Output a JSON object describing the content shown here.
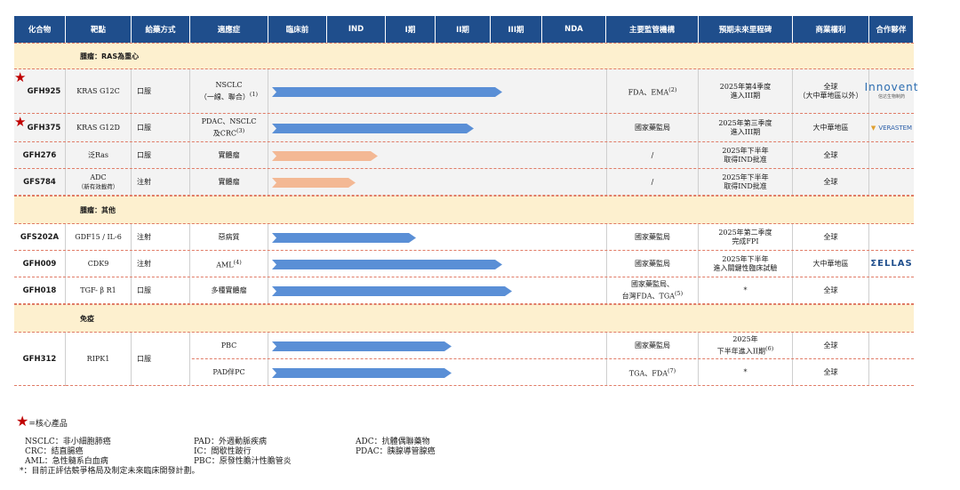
{
  "header": [
    "化合物",
    "靶點",
    "給藥方式",
    "適應症",
    "臨床前",
    "IND",
    "I期",
    "II期",
    "III期",
    "NDA",
    "主要監管機構",
    "預期未來里程碑",
    "商業權利",
    "合作夥伴"
  ],
  "sections": [
    {
      "label": "腫瘤：RAS為重心"
    },
    {
      "label": "腫瘤：其他"
    },
    {
      "label": "免疫"
    }
  ],
  "rows": [
    {
      "compound": "GFH925",
      "core": true,
      "target": "KRAS G12C",
      "route": "口服",
      "indication": "NSCLC",
      "indication_sub": "（一線、聯合）",
      "indication_note": "(1)",
      "stage_progress": 0.72,
      "bar_color": "#5a8fd6",
      "regulator": "FDA、EMA",
      "regulator_note": "(2)",
      "milestone": "2025年第4季度",
      "milestone2": "進入III期",
      "rights": "全球",
      "rights2": "（大中華地區以外）",
      "partner": "Innovent",
      "partner_sub": "信达生物制药"
    },
    {
      "compound": "GFH375",
      "core": true,
      "target": "KRAS G12D",
      "route": "口服",
      "indication": "PDAC、NSCLC",
      "indication_sub": "及CRC",
      "indication_note": "(3)",
      "stage_progress": 0.63,
      "bar_color": "#5a8fd6",
      "regulator": "國家藥監局",
      "regulator_note": "",
      "milestone": "2025年第三季度",
      "milestone2": "進入III期",
      "rights": "大中華地區",
      "rights2": "",
      "partner": "VERASTEM",
      "partner_sub": ""
    },
    {
      "compound": "GFH276",
      "core": false,
      "target": "泛Ras",
      "route": "口服",
      "indication": "實體瘤",
      "indication_sub": "",
      "indication_note": "",
      "stage_progress": 0.33,
      "bar_color": "#f3b894",
      "regulator": "/",
      "regulator_note": "",
      "milestone": "2025年下半年",
      "milestone2": "取得IND批准",
      "rights": "全球",
      "rights2": "",
      "partner": "",
      "partner_sub": ""
    },
    {
      "compound": "GFS784",
      "core": false,
      "target": "ADC",
      "target_sub": "（新有效載荷）",
      "route": "注射",
      "indication": "實體瘤",
      "indication_sub": "",
      "indication_note": "",
      "stage_progress": 0.26,
      "bar_color": "#f3b894",
      "regulator": "/",
      "regulator_note": "",
      "milestone": "2025年下半年",
      "milestone2": "取得IND批准",
      "rights": "全球",
      "rights2": "",
      "partner": "",
      "partner_sub": ""
    },
    {
      "compound": "GFS202A",
      "core": false,
      "target": "GDF15 / IL-6",
      "route": "注射",
      "indication": "惡病質",
      "indication_sub": "",
      "indication_note": "",
      "stage_progress": 0.45,
      "bar_color": "#5a8fd6",
      "regulator": "國家藥監局",
      "regulator_note": "",
      "milestone": "2025年第二季度",
      "milestone2": "完成FPI",
      "rights": "全球",
      "rights2": "",
      "partner": "",
      "partner_sub": ""
    },
    {
      "compound": "GFH009",
      "core": false,
      "target": "CDK9",
      "route": "注射",
      "indication": "AML",
      "indication_sub": "",
      "indication_note": "(4)",
      "stage_progress": 0.72,
      "bar_color": "#5a8fd6",
      "regulator": "國家藥監局",
      "regulator_note": "",
      "milestone": "2025年下半年",
      "milestone2": "進入關鍵性臨床試驗",
      "rights": "大中華地區",
      "rights2": "",
      "partner": "ΣELLAS",
      "partner_sub": ""
    },
    {
      "compound": "GFH018",
      "core": false,
      "target": "TGF- β R1",
      "route": "口服",
      "indication": "多種實體瘤",
      "indication_sub": "",
      "indication_note": "",
      "stage_progress": 0.75,
      "bar_color": "#5a8fd6",
      "regulator": "國家藥監局、",
      "regulator2": "台灣FDA、TGA",
      "regulator_note": "(5)",
      "milestone": "*",
      "milestone2": "",
      "rights": "全球",
      "rights2": "",
      "partner": "",
      "partner_sub": ""
    }
  ],
  "immune": {
    "compound": "GFH312",
    "target": "RIPK1",
    "route": "口服",
    "sub_rows": [
      {
        "indication": "PBC",
        "indication_note": "",
        "stage_progress": 0.56,
        "regulator": "國家藥監局",
        "regulator_note": "",
        "milestone": "2025年",
        "milestone2": "下半年進入II期",
        "milestone_note": "(6)",
        "rights": "全球"
      },
      {
        "indication": "PAD伴PC",
        "indication_note": "",
        "stage_progress": 0.56,
        "regulator": "TGA、FDA",
        "regulator_note": "(7)",
        "milestone": "*",
        "milestone2": "",
        "milestone_note": "",
        "rights": "全球"
      }
    ]
  },
  "legend": {
    "core_label": "=核心產品",
    "col1": [
      "NSCLC：非小細胞肺癌",
      "CRC：結直腸癌",
      "AML：急性髓系白血病"
    ],
    "col2": [
      "PAD：外週動脈疾病",
      "IC：間歇性跛行",
      "PBC：原發性膽汁性膽管炎"
    ],
    "col3": [
      "ADC：抗體偶聯藥物",
      "PDAC：胰腺導管腺癌"
    ],
    "note": "*：目前正評估競爭格局及制定未來臨床開發計劃。"
  }
}
